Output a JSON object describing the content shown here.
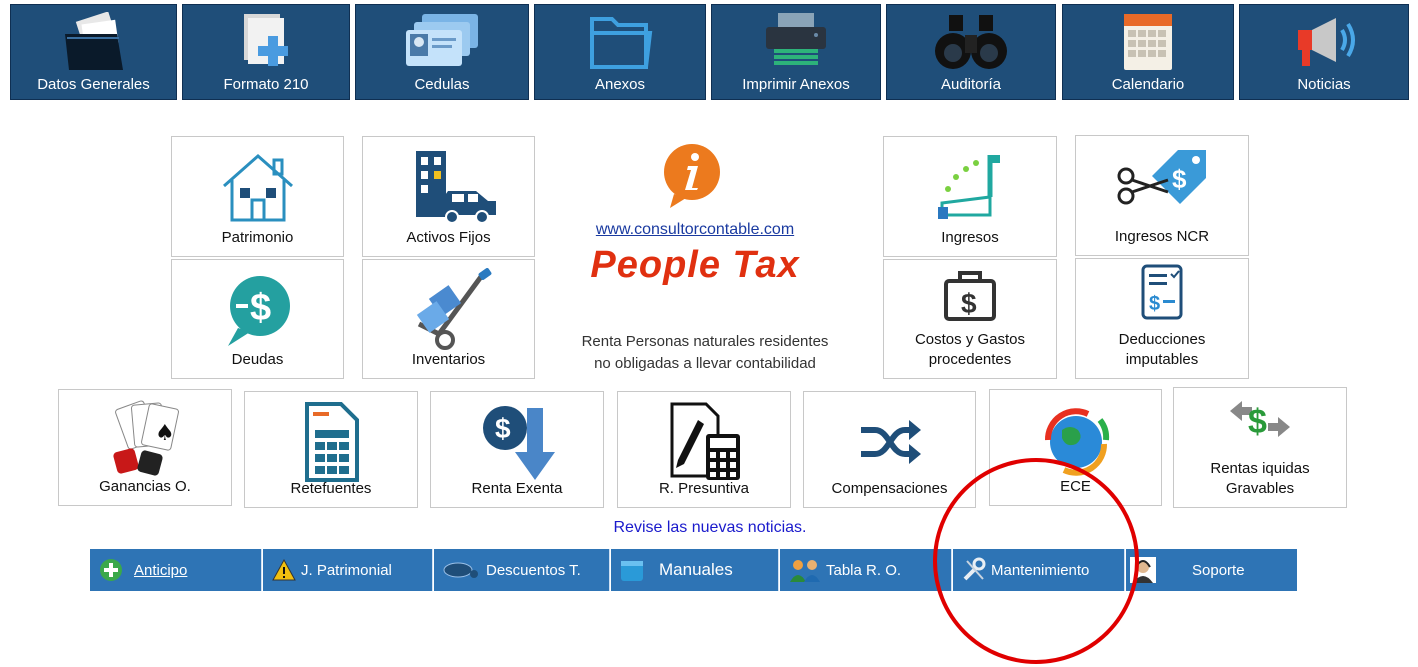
{
  "nav": [
    {
      "label": "Datos Generales",
      "icon": "folder-documents-icon"
    },
    {
      "label": "Formato 210",
      "icon": "add-document-icon"
    },
    {
      "label": "Cedulas",
      "icon": "id-cards-icon"
    },
    {
      "label": "Anexos",
      "icon": "folder-icon"
    },
    {
      "label": "Imprimir Anexos",
      "icon": "printer-icon"
    },
    {
      "label": "Auditoría",
      "icon": "binoculars-icon"
    },
    {
      "label": "Calendario",
      "icon": "calendar-icon"
    },
    {
      "label": "Noticias",
      "icon": "megaphone-icon"
    }
  ],
  "tiles": {
    "patrimonio": "Patrimonio",
    "activos": "Activos Fijos",
    "ingresos": "Ingresos",
    "ingresos_ncr": "Ingresos NCR",
    "deudas": "Deudas",
    "inventarios": "Inventarios",
    "costos": "Costos y Gastos procedentes",
    "deducciones": "Deducciones imputables",
    "ganancias": "Ganancias O.",
    "retefuentes": "Retefuentes",
    "renta_exenta": "Renta Exenta",
    "presuntiva": "R. Presuntiva",
    "compensaciones": "Compensaciones",
    "ece": "ECE",
    "rentas_liquidas": "Rentas iquidas Gravables"
  },
  "center": {
    "url": "www.consultorcontable.com",
    "brand": "People Tax",
    "desc1": "Renta Personas naturales residentes",
    "desc2": "no obligadas a llevar contabilidad"
  },
  "news_link": "Revise las nuevas noticias.",
  "bottom": [
    {
      "label": "Anticipo",
      "icon": "plus-circle-icon"
    },
    {
      "label": "J. Patrimonial",
      "icon": "warning-icon"
    },
    {
      "label": "Descuentos T.",
      "icon": "discount-icon"
    },
    {
      "label": "Manuales",
      "icon": "book-icon"
    },
    {
      "label": "Tabla R. O.",
      "icon": "users-icon"
    },
    {
      "label": "Mantenimiento",
      "icon": "wrench-icon"
    },
    {
      "label": "Soporte",
      "icon": "support-agent-icon"
    }
  ],
  "colors": {
    "nav_bg": "#1f4e79",
    "bottom_bg": "#2e74b5",
    "brand_red": "#e03010",
    "annotation": "#e00000",
    "link": "#1a1acc"
  }
}
